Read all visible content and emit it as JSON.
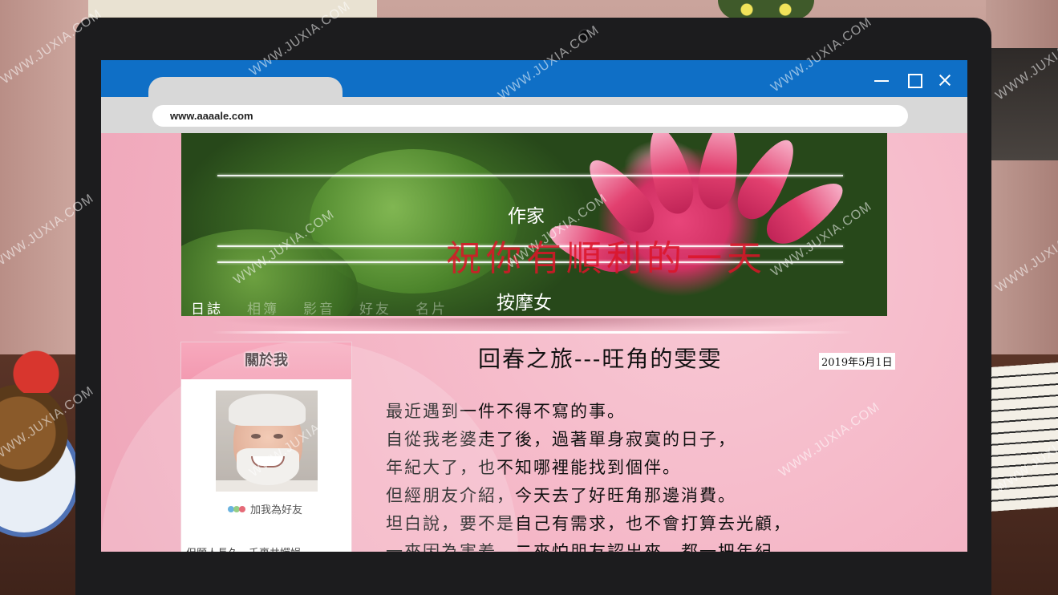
{
  "browser": {
    "url": "www.aaaale.com",
    "controls": {
      "minimize": "minimize-icon",
      "maximize": "maximize-icon",
      "close": "close-icon"
    }
  },
  "banner": {
    "writer_label": "作家",
    "tagline": "祝你有順利的一天",
    "author_label": "按摩女",
    "nav": [
      {
        "label": "日誌",
        "active": true
      },
      {
        "label": "相簿",
        "active": false
      },
      {
        "label": "影音",
        "active": false
      },
      {
        "label": "好友",
        "active": false
      },
      {
        "label": "名片",
        "active": false
      }
    ]
  },
  "sidebar": {
    "heading": "關於我",
    "add_friend": "加我為好友",
    "motto": "但願人長久，千裏共嬋娟。"
  },
  "post": {
    "title": "回春之旅---旺角的雯雯",
    "date": "2019年5月1日",
    "lines": [
      "最近遇到一件不得不寫的事。",
      "自從我老婆走了後，過著單身寂寞的日子，",
      "年紀大了，也不知哪裡能找到個伴。",
      "但經朋友介紹，今天去了好旺角那邊消費。",
      "坦白說，要不是自己有需求，也不會打算去光顧，",
      "一來因為害羞，二來怕朋友認出來，都一把年紀，"
    ]
  },
  "watermark": "WWW.JUXIA.COM",
  "colors": {
    "titlebar": "#0f6fc6",
    "page_bg": "#f4b9c7",
    "tagline": "#dc1428"
  }
}
